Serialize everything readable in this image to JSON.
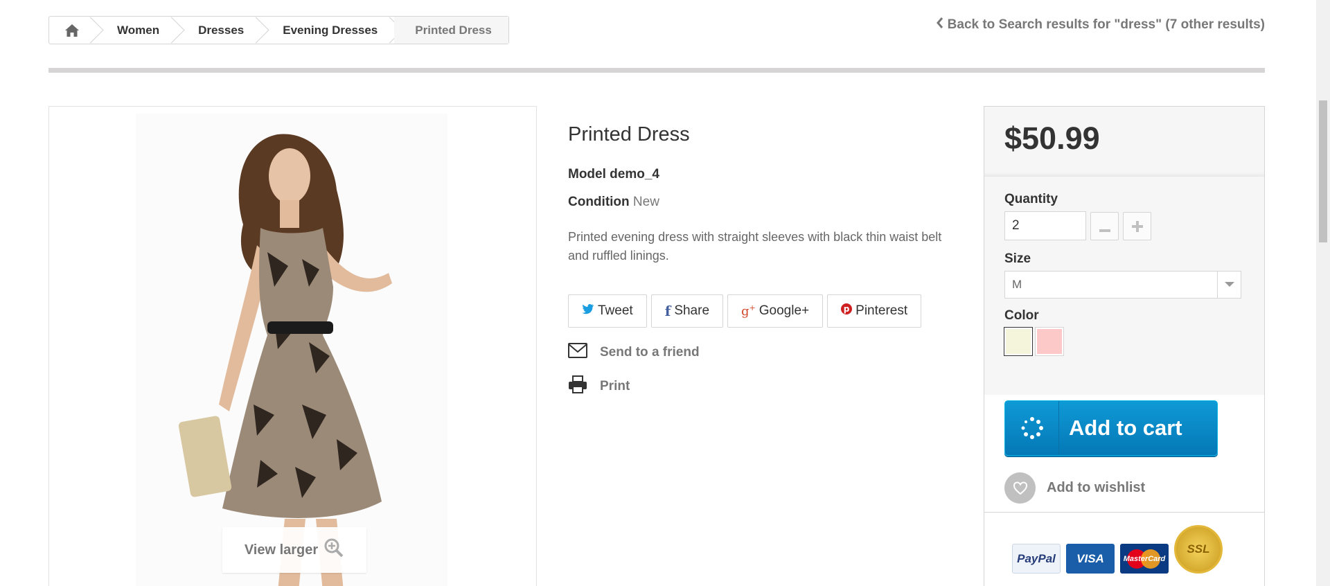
{
  "breadcrumb": {
    "items": [
      "Women",
      "Dresses",
      "Evening Dresses"
    ],
    "current": "Printed Dress"
  },
  "back_link": "Back to Search results for \"dress\" (7 other results)",
  "image_panel": {
    "view_larger": "View larger"
  },
  "product": {
    "title": "Printed Dress",
    "model_label": "Model",
    "model_value": "demo_4",
    "condition_label": "Condition",
    "condition_value": "New",
    "description": "Printed evening dress with straight sleeves with black thin waist belt and ruffled linings."
  },
  "social": {
    "tweet": "Tweet",
    "share": "Share",
    "google": "Google+",
    "pinterest": "Pinterest"
  },
  "actions": {
    "send_friend": "Send to a friend",
    "print": "Print"
  },
  "buybox": {
    "price": "$50.99",
    "quantity_label": "Quantity",
    "quantity_value": "2",
    "size_label": "Size",
    "size_value": "M",
    "color_label": "Color",
    "colors": [
      "#f5f5dc",
      "#fcc8c8"
    ],
    "add_to_cart": "Add to cart",
    "wishlist": "Add to wishlist",
    "payments": [
      "PayPal",
      "VISA",
      "MasterCard",
      "SSL"
    ]
  },
  "colors": {
    "cart_button": "#0f9ad6",
    "border": "#d6d4d4",
    "text_muted": "#777777"
  }
}
